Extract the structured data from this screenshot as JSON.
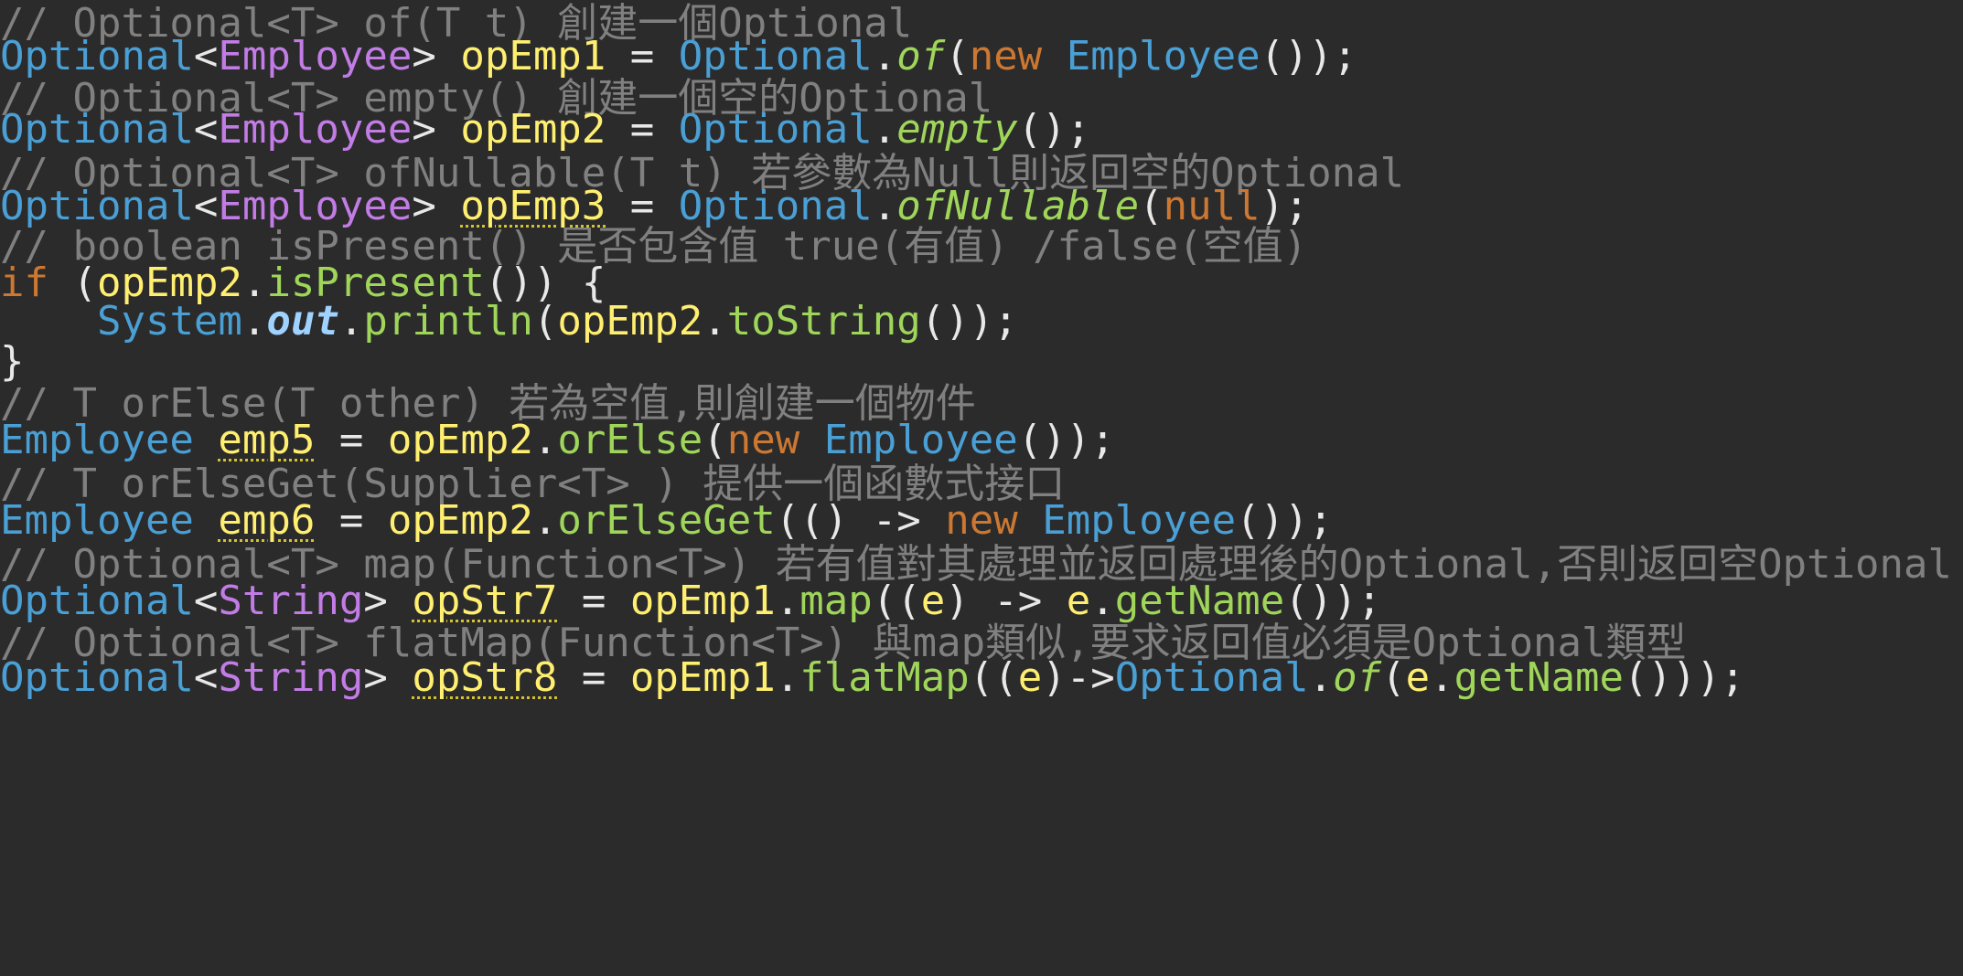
{
  "editor": {
    "lines": [
      "// Optional<T> of(T t) 創建一個Optional",
      "Optional<Employee> opEmp1 = Optional.of(new Employee());",
      "// Optional<T> empty() 創建一個空的Optional",
      "Optional<Employee> opEmp2 = Optional.empty();",
      "// Optional<T> ofNullable(T t) 若參數為Null則返回空的Optional",
      "Optional<Employee> opEmp3 = Optional.ofNullable(null);",
      "// boolean isPresent() 是否包含值 true(有值) /false(空值)",
      "if (opEmp2.isPresent()) {",
      "    System.out.println(opEmp2.toString());",
      "}",
      "// T orElse(T other) 若為空值,則創建一個物件",
      "Employee emp5 = opEmp2.orElse(new Employee());",
      "// T orElseGet(Supplier<T> ) 提供一個函數式接口",
      "Employee emp6 = opEmp2.orElseGet(() -> new Employee());",
      "// Optional<T> map(Function<T>) 若有值對其處理並返回處理後的Optional,否則返回空Optional",
      "Optional<String> opStr7 = opEmp1.map((e) -> e.getName());",
      "// Optional<T> flatMap(Function<T>) 與map類似,要求返回值必須是Optional類型",
      "Optional<String> opStr8 = opEmp1.flatMap((e)->Optional.of(e.getName()));"
    ],
    "colors": {
      "background": "#2b2b2b",
      "comment": "#808080",
      "type": "#4a9fd5",
      "generic": "#c27ce6",
      "variable": "#ffef70",
      "keyword": "#cc7832",
      "method": "#9fd65a",
      "field": "#9fd2ff",
      "punctuation": "#e8e8e8",
      "warning_underline": "#d4c22d"
    }
  }
}
